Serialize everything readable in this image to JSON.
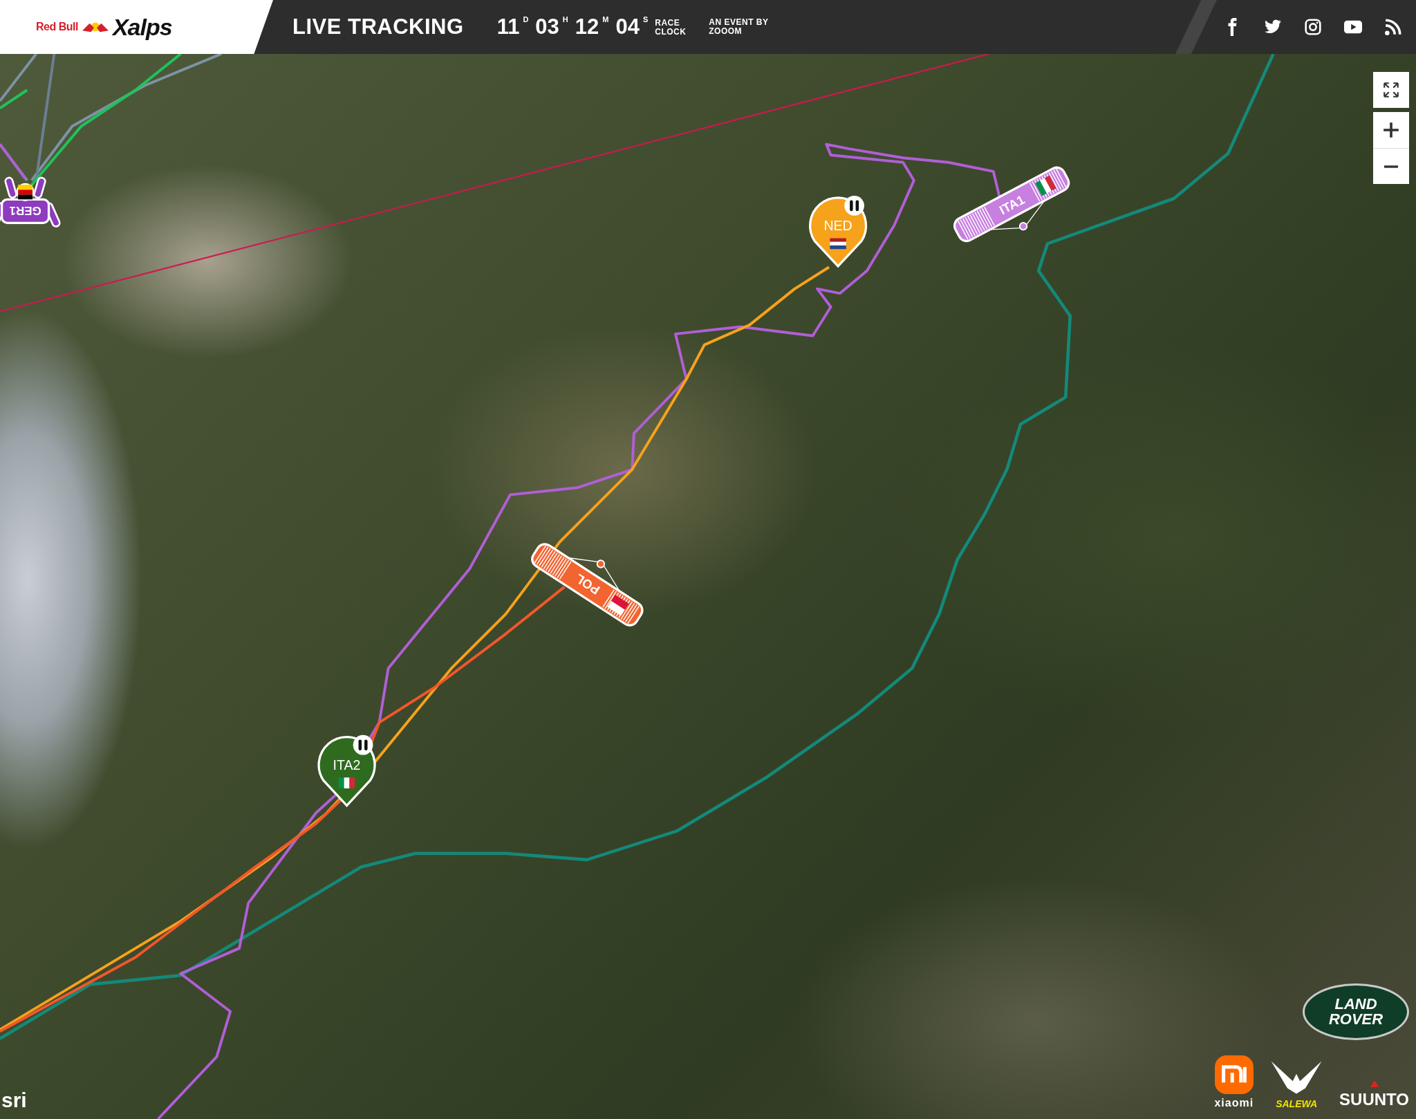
{
  "header": {
    "logo": {
      "sponsor": "Red Bull",
      "name": "Xalps"
    },
    "title": "LIVE TRACKING",
    "clock": [
      {
        "value": "11",
        "unit": "D"
      },
      {
        "value": "03",
        "unit": "H"
      },
      {
        "value": "12",
        "unit": "M"
      },
      {
        "value": "04",
        "unit": "S"
      }
    ],
    "clock_label": "RACE CLOCK",
    "event_by": "AN EVENT BY",
    "organizer": "ZOOOM"
  },
  "pilots": [
    {
      "label": "GER1",
      "kind": "walker",
      "color": "#8e3bbf",
      "flag": {
        "kind": "de"
      },
      "paused": false
    },
    {
      "label": "NED",
      "kind": "pin",
      "color": "#f7a21b",
      "flag": {
        "kind": "nl"
      },
      "paused": true
    },
    {
      "label": "ITA1",
      "kind": "glider",
      "color": "#c77fe0",
      "flag": {
        "kind": "it"
      },
      "paused": false
    },
    {
      "label": "POL",
      "kind": "glider",
      "color": "#f26430",
      "flag": {
        "kind": "pl"
      },
      "paused": false
    },
    {
      "label": "ITA2",
      "kind": "pin",
      "color": "#2f6b1f",
      "flag": {
        "kind": "it"
      },
      "paused": true
    }
  ],
  "attribution": "sri",
  "sponsors": [
    {
      "name": "LAND ROVER",
      "kind": "landrover"
    },
    {
      "name": "xiaomi",
      "kind": "xiaomi"
    },
    {
      "name": "SALEWA",
      "kind": "salewa"
    },
    {
      "name": "SUUNTO",
      "kind": "suunto"
    }
  ]
}
